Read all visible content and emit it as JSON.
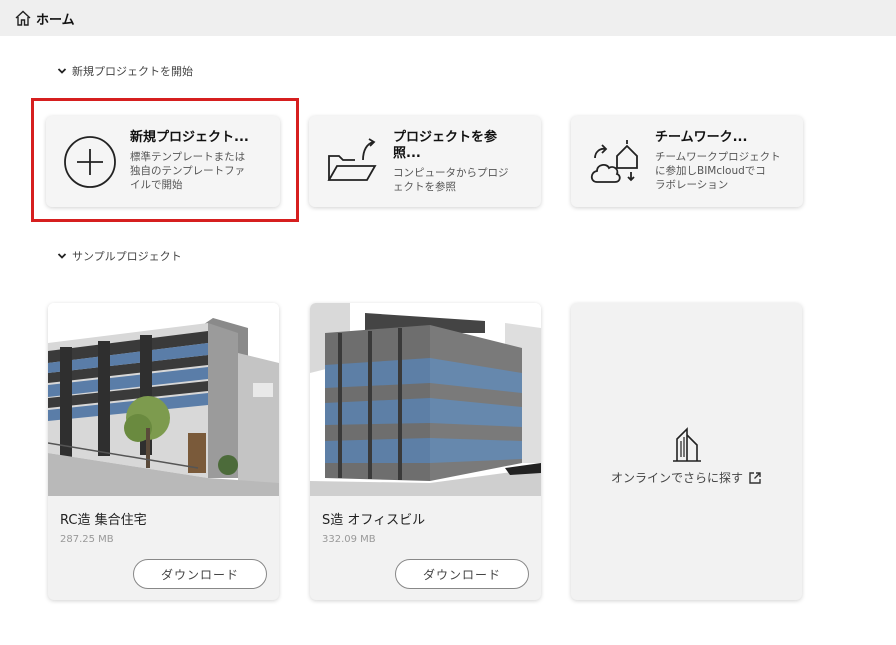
{
  "header": {
    "title": "ホーム",
    "icon": "home-icon"
  },
  "new_section": {
    "label": "新規プロジェクトを開始"
  },
  "tiles": [
    {
      "title": "新規プロジェクト...",
      "desc": [
        "標準テンプレートまたは",
        "独自のテンプレートファ",
        "イルで開始"
      ],
      "icon": "plus-circle-icon"
    },
    {
      "title": "プロジェクトを参照...",
      "title_lines": [
        "プロジェクトを参",
        "照..."
      ],
      "desc": [
        "コンピュータからプロジ",
        "ェクトを参照"
      ],
      "icon": "open-folder-icon"
    },
    {
      "title": "チームワーク...",
      "desc": [
        "チームワークプロジェクト",
        "に参加しBIMcloudでコ",
        "ラボレーション"
      ],
      "icon": "cloud-teamwork-icon"
    }
  ],
  "sample_section": {
    "label": "サンプルプロジェクト"
  },
  "samples": [
    {
      "title": "RC造 集合住宅",
      "size": "287.25 MB",
      "button": "ダウンロード"
    },
    {
      "title": "S造 オフィスビル",
      "size": "332.09 MB",
      "button": "ダウンロード"
    }
  ],
  "online": {
    "label": "オンラインでさらに探す",
    "icon": "external-link-icon"
  },
  "colors": {
    "highlight": "#d61f1f",
    "header_bg": "#efefef",
    "tile_bg": "#f5f5f5"
  }
}
